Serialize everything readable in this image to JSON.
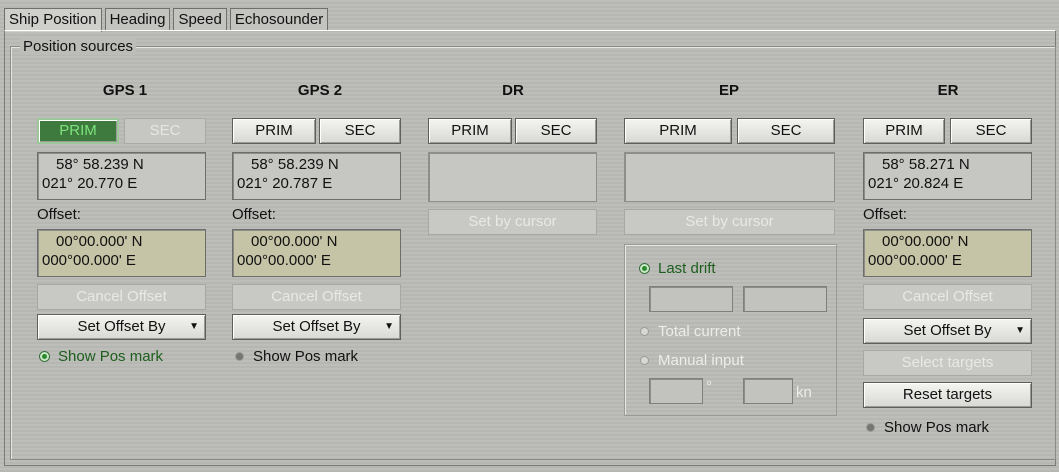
{
  "tabs": [
    "Ship Position",
    "Heading",
    "Speed",
    "Echosounder"
  ],
  "group_label": "Position sources",
  "columns": {
    "gps1": {
      "title": "GPS 1",
      "prim": "PRIM",
      "sec": "SEC",
      "lat": "58° 58.239 N",
      "lon": "021° 20.770 E",
      "offset_label": "Offset:",
      "off_lat": "00°00.000' N",
      "off_lon": "000°00.000' E",
      "cancel": "Cancel Offset",
      "set_offset": "Set Offset By",
      "show_pos": "Show Pos mark"
    },
    "gps2": {
      "title": "GPS 2",
      "prim": "PRIM",
      "sec": "SEC",
      "lat": "58° 58.239 N",
      "lon": "021° 20.787 E",
      "offset_label": "Offset:",
      "off_lat": "00°00.000' N",
      "off_lon": "000°00.000' E",
      "cancel": "Cancel Offset",
      "set_offset": "Set Offset By",
      "show_pos": "Show Pos mark"
    },
    "dr": {
      "title": "DR",
      "prim": "PRIM",
      "sec": "SEC",
      "set_cursor": "Set by cursor"
    },
    "ep": {
      "title": "EP",
      "prim": "PRIM",
      "sec": "SEC",
      "set_cursor": "Set by cursor",
      "last_drift": "Last drift",
      "total_current": "Total current",
      "manual_input": "Manual input",
      "deg_unit": "°",
      "kn_unit": "kn"
    },
    "er": {
      "title": "ER",
      "prim": "PRIM",
      "sec": "SEC",
      "lat": "58° 58.271 N",
      "lon": "021° 20.824 E",
      "offset_label": "Offset:",
      "off_lat": "00°00.000' N",
      "off_lon": "000°00.000' E",
      "cancel": "Cancel Offset",
      "set_offset": "Set Offset By",
      "select_targets": "Select targets",
      "reset_targets": "Reset targets",
      "show_pos": "Show Pos mark"
    }
  },
  "icons": {
    "dropdown": "chevron-down-icon",
    "radio": "radio-icon"
  },
  "colors": {
    "prim_active": "#3e7a3e",
    "offset_field": "#c5c4a6",
    "radio_active": "#2c8a2c"
  }
}
